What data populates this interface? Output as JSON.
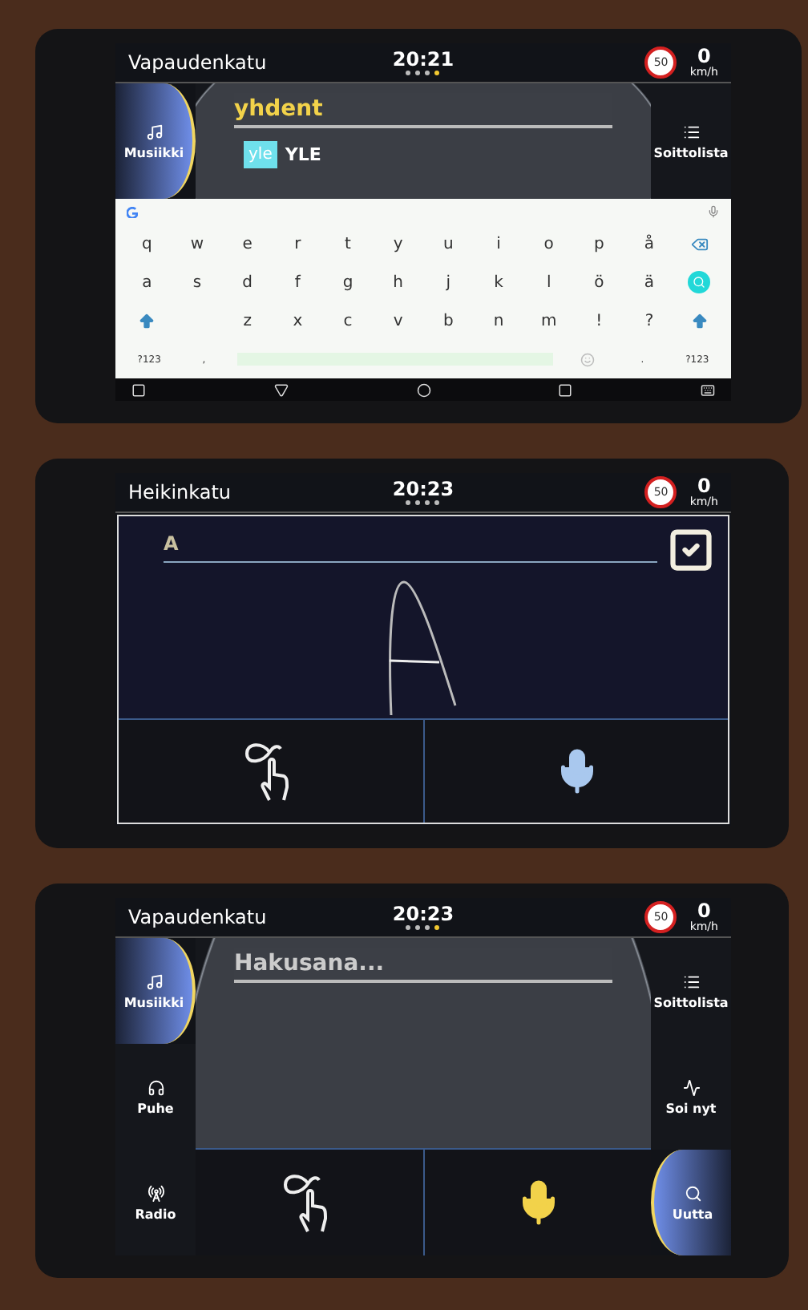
{
  "screens": [
    {
      "kind": "search_keyboard",
      "status": {
        "street": "Vapaudenkatu",
        "time": "20:21",
        "page_dots": [
          {
            "selected": false
          },
          {
            "selected": false
          },
          {
            "selected": false
          },
          {
            "selected": true
          }
        ],
        "speed_limit": "50",
        "speed": "0",
        "speed_unit": "km/h"
      },
      "left_tabs": [
        {
          "label": "Musiikki",
          "kind": "music",
          "selected": true
        }
      ],
      "right_tabs": [
        {
          "label": "Soittolista",
          "kind": "list",
          "selected": false
        }
      ],
      "search": {
        "value": "yhdent"
      },
      "results": [
        {
          "logo": "yle",
          "label": "YLE"
        }
      ],
      "keyboard": {
        "rows": [
          [
            {
              "kind": "char",
              "label": "q"
            },
            {
              "kind": "char",
              "label": "w"
            },
            {
              "kind": "char",
              "label": "e"
            },
            {
              "kind": "char",
              "label": "r"
            },
            {
              "kind": "char",
              "label": "t"
            },
            {
              "kind": "char",
              "label": "y"
            },
            {
              "kind": "char",
              "label": "u"
            },
            {
              "kind": "char",
              "label": "i"
            },
            {
              "kind": "char",
              "label": "o"
            },
            {
              "kind": "char",
              "label": "p"
            },
            {
              "kind": "char",
              "label": "å"
            },
            {
              "kind": "backspace"
            }
          ],
          [
            {
              "kind": "char",
              "label": "a"
            },
            {
              "kind": "char",
              "label": "s"
            },
            {
              "kind": "char",
              "label": "d"
            },
            {
              "kind": "char",
              "label": "f"
            },
            {
              "kind": "char",
              "label": "g"
            },
            {
              "kind": "char",
              "label": "h"
            },
            {
              "kind": "char",
              "label": "j"
            },
            {
              "kind": "char",
              "label": "k"
            },
            {
              "kind": "char",
              "label": "l"
            },
            {
              "kind": "char",
              "label": "ö"
            },
            {
              "kind": "char",
              "label": "ä"
            },
            {
              "kind": "search"
            }
          ],
          [
            {
              "kind": "shift"
            },
            {
              "kind": "gap"
            },
            {
              "kind": "char",
              "label": "z"
            },
            {
              "kind": "char",
              "label": "x"
            },
            {
              "kind": "char",
              "label": "c"
            },
            {
              "kind": "char",
              "label": "v"
            },
            {
              "kind": "char",
              "label": "b"
            },
            {
              "kind": "char",
              "label": "n"
            },
            {
              "kind": "char",
              "label": "m"
            },
            {
              "kind": "char",
              "label": "!"
            },
            {
              "kind": "char",
              "label": "?"
            },
            {
              "kind": "shift"
            }
          ],
          [
            {
              "kind": "small",
              "label": "?123"
            },
            {
              "kind": "small",
              "label": ","
            },
            {
              "kind": "space"
            },
            {
              "kind": "emoji"
            },
            {
              "kind": "small",
              "label": "."
            },
            {
              "kind": "small",
              "label": "?123"
            }
          ]
        ]
      }
    },
    {
      "kind": "handwriting",
      "status": {
        "street": "Heikinkatu",
        "time": "20:23",
        "page_dots": [
          {
            "selected": false
          },
          {
            "selected": false
          },
          {
            "selected": false
          },
          {
            "selected": false
          }
        ],
        "speed_limit": "50",
        "speed": "0",
        "speed_unit": "km/h"
      },
      "input": {
        "value": "A"
      },
      "buttons": [
        {
          "kind": "handwriting",
          "active": false
        },
        {
          "kind": "mic",
          "active": false
        }
      ]
    },
    {
      "kind": "search",
      "status": {
        "street": "Vapaudenkatu",
        "time": "20:23",
        "page_dots": [
          {
            "selected": false
          },
          {
            "selected": false
          },
          {
            "selected": false
          },
          {
            "selected": true
          }
        ],
        "speed_limit": "50",
        "speed": "0",
        "speed_unit": "km/h"
      },
      "left_tabs": [
        {
          "label": "Musiikki",
          "kind": "music",
          "selected": true
        },
        {
          "label": "Puhe",
          "kind": "headphones",
          "selected": false
        },
        {
          "label": "Radio",
          "kind": "antenna",
          "selected": false
        }
      ],
      "right_tabs": [
        {
          "label": "Soittolista",
          "kind": "list",
          "selected": false
        },
        {
          "label": "Soi nyt",
          "kind": "pulse",
          "selected": false
        },
        {
          "label": "Uutta",
          "kind": "search",
          "selected": true
        }
      ],
      "search": {
        "placeholder": "Hakusana..."
      },
      "buttons": [
        {
          "kind": "handwriting",
          "active": false
        },
        {
          "kind": "mic",
          "active": true
        }
      ]
    }
  ]
}
